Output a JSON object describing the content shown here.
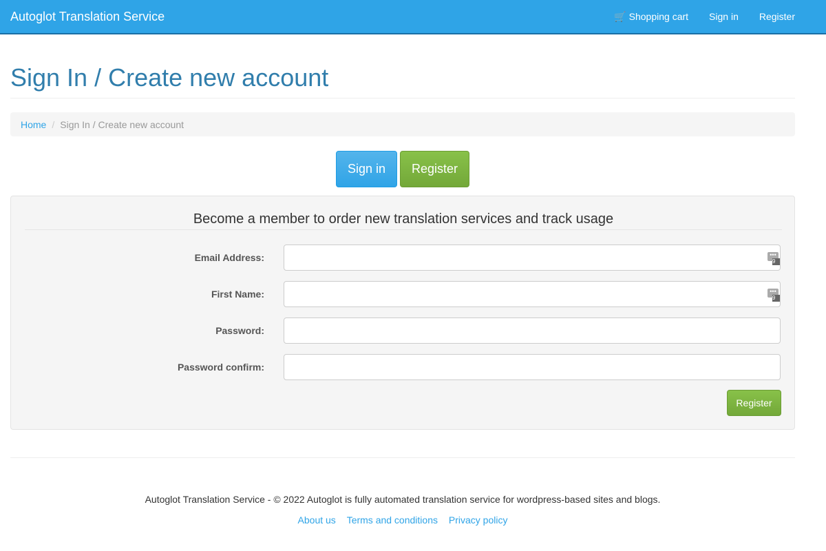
{
  "nav": {
    "brand": "Autoglot Translation Service",
    "cart": "Shopping cart",
    "signin": "Sign in",
    "register": "Register"
  },
  "page_title": "Sign In / Create new account",
  "breadcrumb": {
    "home": "Home",
    "current": "Sign In / Create new account"
  },
  "tabs": {
    "signin": "Sign in",
    "register": "Register"
  },
  "form": {
    "legend": "Become a member to order new translation services and track usage",
    "fields": [
      {
        "label": "Email Address:",
        "value": ""
      },
      {
        "label": "First Name:",
        "value": ""
      },
      {
        "label": "Password:",
        "value": ""
      },
      {
        "label": "Password confirm:",
        "value": ""
      }
    ],
    "submit": "Register"
  },
  "footer": {
    "text": "Autoglot Translation Service - © 2022 Autoglot is fully automated translation service for wordpress-based sites and blogs.",
    "links": [
      "About us",
      "Terms and conditions",
      "Privacy policy"
    ]
  }
}
